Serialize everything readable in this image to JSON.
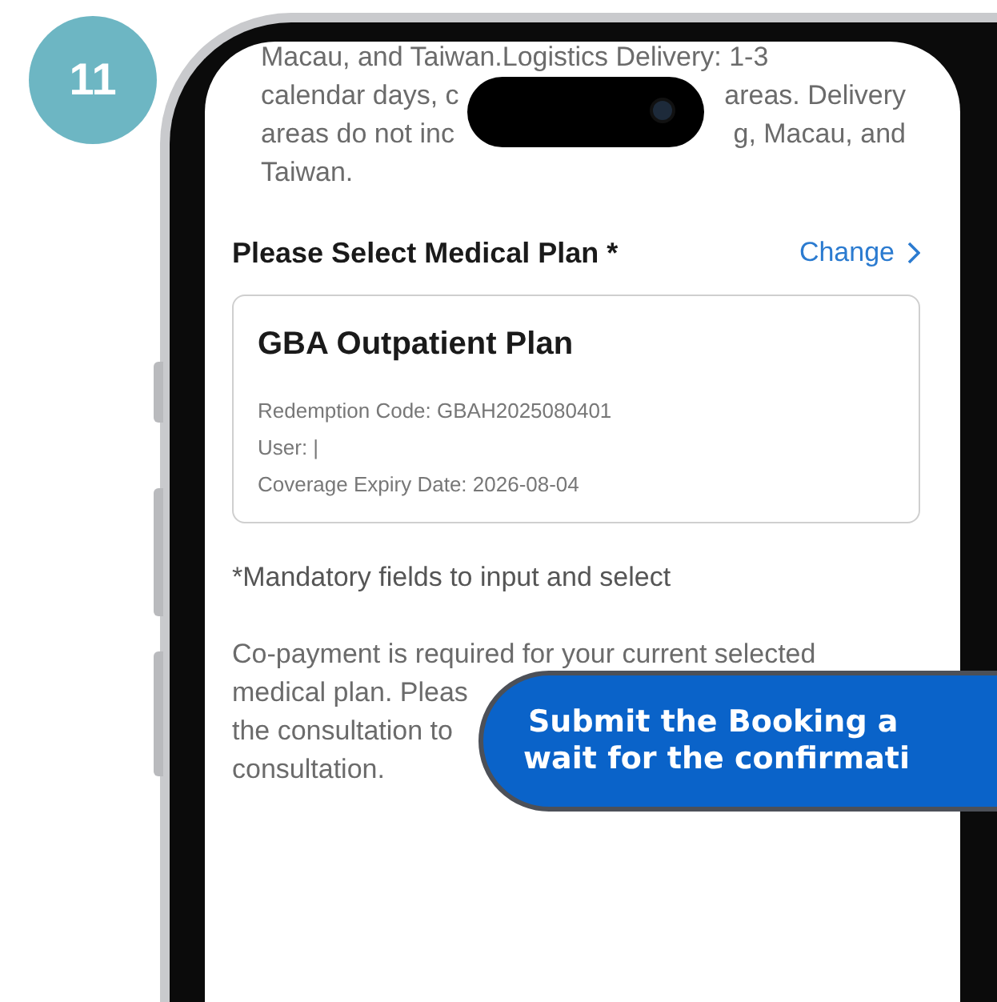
{
  "step_badge": "11",
  "delivery_note": {
    "lines": [
      {
        "left": "Macau, and Taiwan.Logistics Delivery: 1-3"
      },
      {
        "left": "calendar days, c",
        "right": "areas. Delivery"
      },
      {
        "left": "areas do not inc",
        "right": "g, Macau, and"
      },
      {
        "left": "Taiwan."
      }
    ]
  },
  "medical_plan": {
    "heading": "Please Select Medical Plan *",
    "change_link": "Change",
    "card": {
      "title": "GBA Outpatient Plan",
      "details": [
        "Redemption Code: GBAH2025080401",
        "User: |",
        "Coverage Expiry Date: 2026-08-04"
      ]
    }
  },
  "mandatory_note": "*Mandatory fields to input and select",
  "copayment_note": {
    "lines": [
      "Co-payment is required for your current selected",
      "medical plan. Pleas",
      "the consultation to",
      "consultation."
    ]
  },
  "callout": {
    "lines": [
      "Submit the Booking a",
      "wait for the confirmati"
    ]
  }
}
